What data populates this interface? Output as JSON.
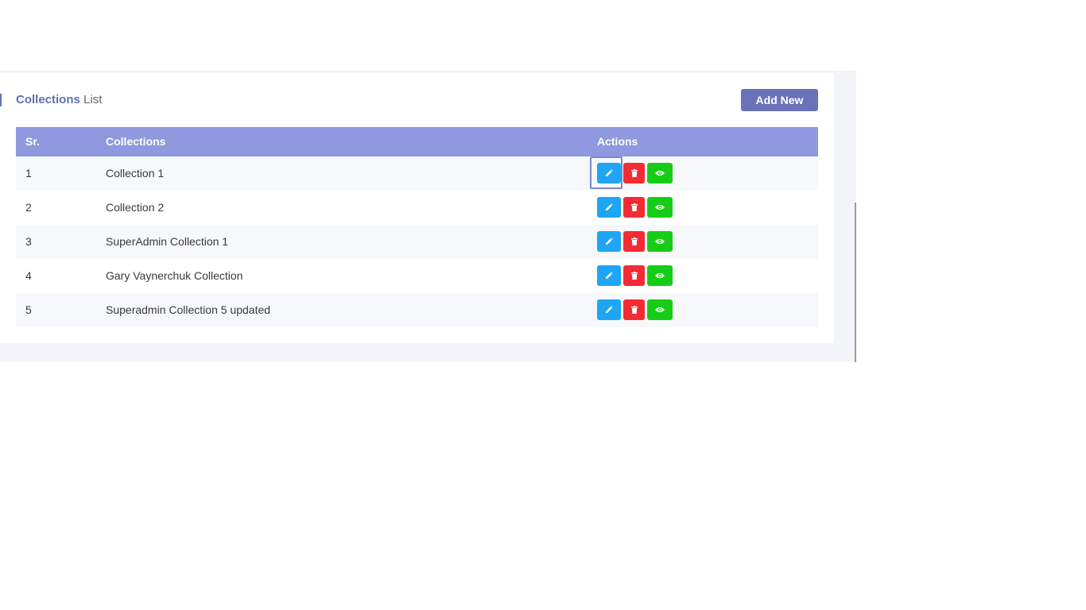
{
  "card": {
    "title_strong": "Collections",
    "title_rest": "List",
    "add_button_label": "Add New"
  },
  "table": {
    "headers": {
      "sr": "Sr.",
      "name": "Collections",
      "actions": "Actions"
    },
    "rows": [
      {
        "sr": "1",
        "name": "Collection 1"
      },
      {
        "sr": "2",
        "name": "Collection 2"
      },
      {
        "sr": "3",
        "name": "SuperAdmin Collection 1"
      },
      {
        "sr": "4",
        "name": "Gary Vaynerchuk Collection"
      },
      {
        "sr": "5",
        "name": "Superadmin Collection 5 updated"
      }
    ]
  },
  "icons": {
    "edit": "pencil-icon",
    "delete": "trash-icon",
    "view": "eye-icon"
  },
  "colors": {
    "accent": "#6a72b9",
    "table_header": "#8e99df",
    "edit": "#1ea5f5",
    "delete": "#f52b34",
    "view": "#16cd16"
  }
}
